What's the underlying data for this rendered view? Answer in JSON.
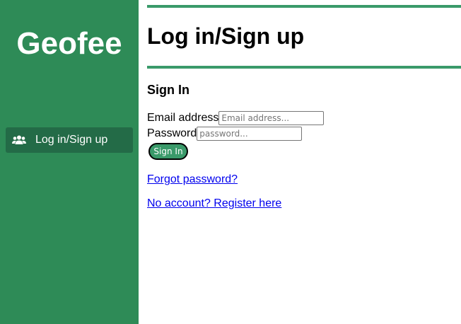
{
  "sidebar": {
    "brand": "Geofee",
    "items": [
      {
        "label": "Log in/Sign up",
        "icon": "users-icon"
      }
    ],
    "colors": {
      "background": "#2e8b57",
      "active_item": "#236b47"
    }
  },
  "main": {
    "title": "Log in/Sign up",
    "section_title": "Sign In",
    "email": {
      "label": "Email address",
      "placeholder": "Email address...",
      "value": ""
    },
    "password": {
      "label": "Password",
      "placeholder": "password...",
      "value": ""
    },
    "sign_in_label": "Sign In",
    "forgot_link": "Forgot password?",
    "register_link": "No account? Register here",
    "colors": {
      "rule": "#3a9a6a",
      "button": "#3a9a6a",
      "link": "#0000ee"
    }
  }
}
